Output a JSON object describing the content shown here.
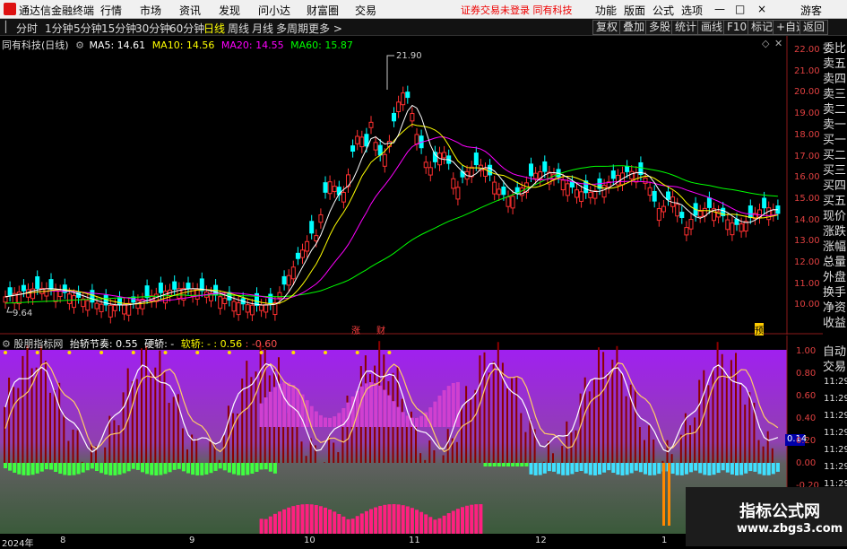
{
  "titlebar": {
    "app_name": "通达信金融终端",
    "menus": [
      "行情",
      "市场",
      "资讯",
      "发现",
      "问小达",
      "财富圈",
      "交易"
    ],
    "warning": "证券交易未登录  同有科技",
    "right_menus": [
      "功能",
      "版面",
      "公式",
      "选项"
    ],
    "guest": "游客",
    "window_controls": [
      "—",
      "□",
      "×"
    ]
  },
  "toolbar": {
    "periods": [
      "分时",
      "1分钟",
      "5分钟",
      "15分钟",
      "30分钟",
      "60分钟",
      "日线",
      "周线",
      "月线",
      "多周期",
      "更多 >"
    ],
    "active_period": "日线",
    "right_buttons": [
      "复权",
      "叠加",
      "多股",
      "统计",
      "画线",
      "F10",
      "标记",
      "+自选",
      "返回"
    ]
  },
  "main_chart": {
    "stock_label": "同有科技(日线)",
    "ma5": "MA5: 14.61",
    "ma10": "MA10: 14.56",
    "ma20": "MA20: 14.55",
    "ma60": "MA60: 15.87",
    "high_label": "21.90",
    "low_label": "9.64",
    "event_tags": [
      "涨",
      "财",
      "预"
    ],
    "colors": {
      "up": "#ff3030",
      "down": "#00ffff",
      "ma5": "#ffffff",
      "ma10": "#ffff00",
      "ma20": "#ff00ff",
      "ma60": "#00ff00"
    }
  },
  "price_axis": [
    "22.00",
    "21.00",
    "20.00",
    "19.00",
    "18.00",
    "17.00",
    "16.00",
    "15.00",
    "14.00",
    "13.00",
    "12.00",
    "11.00",
    "10.00"
  ],
  "side_panel": {
    "upper": [
      "委比",
      "卖五",
      "卖四",
      "卖三",
      "卖二",
      "卖一",
      "买一",
      "买二",
      "买三",
      "买四",
      "买五",
      "现价",
      "涨跌",
      "涨幅",
      "总量",
      "外盘",
      "换手",
      "净资",
      "收益"
    ],
    "lower": [
      "自动",
      "交易"
    ]
  },
  "sub_chart": {
    "indicator_name": "股朋指标网",
    "line1": "抬轿节奏: 0.55",
    "line2": "硬轿: -",
    "line3": "软轿: - : 0.56",
    "line4": ": -0.60",
    "axis": [
      "1.00",
      "0.80",
      "0.60",
      "0.40",
      "0.20",
      "0.00",
      "-0.20"
    ],
    "current_value": "0.14"
  },
  "time_axis": [
    "11:29",
    "11:29",
    "11:29",
    "11:29",
    "11:29",
    "11:29",
    "11:29",
    "11:29",
    "11:29"
  ],
  "dates": [
    "2024年",
    "8",
    "9",
    "10",
    "11",
    "12",
    "1"
  ],
  "watermark": {
    "line1": "指标公式网",
    "line2": "www.zbgs3.com"
  }
}
